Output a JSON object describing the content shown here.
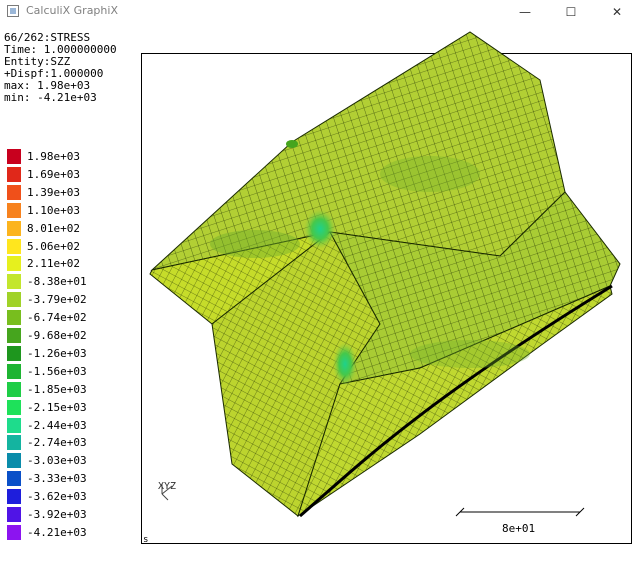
{
  "window": {
    "title": "CalculiX GraphiX",
    "minimize_glyph": "—",
    "maximize_glyph": "☐",
    "close_glyph": "✕"
  },
  "info": {
    "line1": "66/262:STRESS",
    "line2": "Time: 1.000000000",
    "line3": "Entity:SZZ",
    "line4": "+Dispf:1.000000",
    "line5": "max: 1.98e+03",
    "line6": "min: -4.21e+03"
  },
  "legend": [
    {
      "label": "1.98e+03",
      "color": "#c8001e"
    },
    {
      "label": "1.69e+03",
      "color": "#e0281a"
    },
    {
      "label": "1.39e+03",
      "color": "#f0501a"
    },
    {
      "label": "1.10e+03",
      "color": "#f7821e"
    },
    {
      "label": "8.01e+02",
      "color": "#fcb41e"
    },
    {
      "label": "5.06e+02",
      "color": "#ffe61e"
    },
    {
      "label": "2.11e+02",
      "color": "#e6f01e"
    },
    {
      "label": "-8.38e+01",
      "color": "#c3e62d"
    },
    {
      "label": "-3.79e+02",
      "color": "#a0d228"
    },
    {
      "label": "-6.74e+02",
      "color": "#78be1e"
    },
    {
      "label": "-9.68e+02",
      "color": "#46a51e"
    },
    {
      "label": "-1.26e+03",
      "color": "#1e961e"
    },
    {
      "label": "-1.56e+03",
      "color": "#1eb432"
    },
    {
      "label": "-1.85e+03",
      "color": "#1ecd46"
    },
    {
      "label": "-2.15e+03",
      "color": "#1ee15a"
    },
    {
      "label": "-2.44e+03",
      "color": "#1edc8c"
    },
    {
      "label": "-2.74e+03",
      "color": "#14b4a0"
    },
    {
      "label": "-3.03e+03",
      "color": "#0a8caa"
    },
    {
      "label": "-3.33e+03",
      "color": "#0a50c8"
    },
    {
      "label": "-3.62e+03",
      "color": "#1e1edc"
    },
    {
      "label": "-3.92e+03",
      "color": "#5014e6"
    },
    {
      "label": "-4.21e+03",
      "color": "#8c14f0"
    }
  ],
  "axes_label": "XYZ",
  "scale_label": "8e+01",
  "corner_label": "s",
  "colors": {
    "mesh_fill": "#b9d431",
    "mesh_line": "#1a2a00",
    "hotspot": "#32d76e"
  }
}
